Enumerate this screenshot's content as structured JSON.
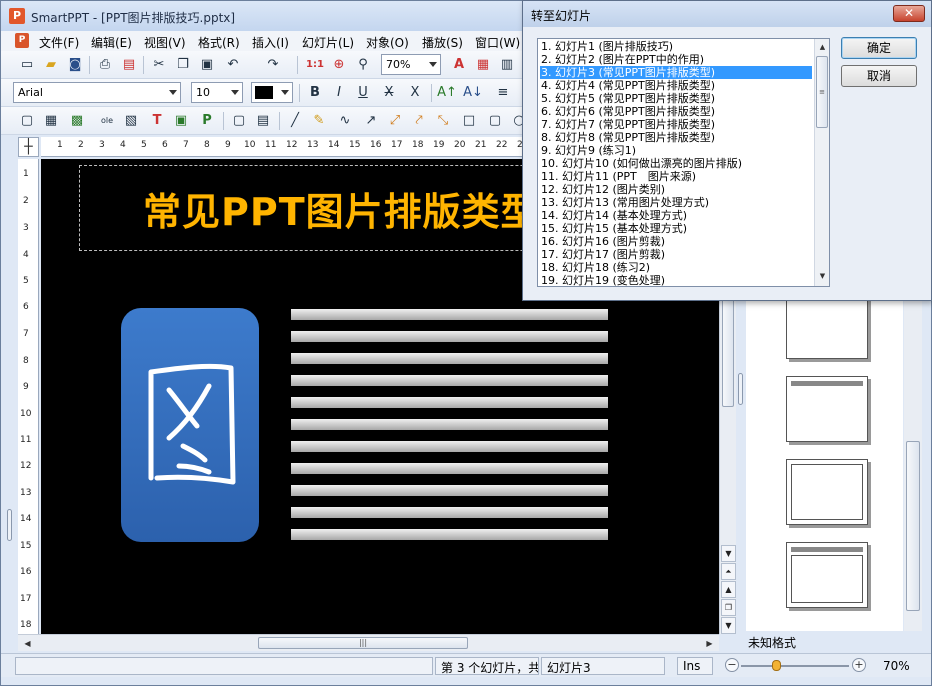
{
  "window": {
    "title": "SmartPPT - [PPT图片排版技巧.pptx]"
  },
  "menu": [
    "文件(F)",
    "编辑(E)",
    "视图(V)",
    "格式(R)",
    "插入(I)",
    "幻灯片(L)",
    "对象(O)",
    "播放(S)",
    "窗口(W)"
  ],
  "toolbar": {
    "zoom_value": "70%",
    "font_name": "Arial",
    "font_size": "10"
  },
  "ruler": {
    "h_ticks": [
      "1",
      "2",
      "3",
      "4",
      "5",
      "6",
      "7",
      "8",
      "9",
      "10",
      "11",
      "12",
      "13",
      "14",
      "15",
      "16",
      "17",
      "18",
      "19",
      "20",
      "21",
      "22",
      "23"
    ],
    "v_ticks": [
      "1",
      "2",
      "3",
      "4",
      "5",
      "6",
      "7",
      "8",
      "9",
      "10",
      "11",
      "12",
      "13",
      "14",
      "15",
      "16",
      "17",
      "18"
    ]
  },
  "slide": {
    "title": "常见PPT图片排版类型",
    "picture_glyph": "图"
  },
  "thumbs": {
    "format_label": "未知格式"
  },
  "status": {
    "slide_info": "第 3 个幻灯片，共",
    "slide_name": "幻灯片3",
    "mode": "Ins",
    "zoom": "70%"
  },
  "dialog": {
    "title": "转至幻灯片",
    "close": "✕",
    "ok": "确定",
    "cancel": "取消",
    "items": [
      "1. 幻灯片1 (图片排版技巧)",
      "2. 幻灯片2 (图片在PPT中的作用)",
      "3. 幻灯片3 (常见PPT图片排版类型)",
      "4. 幻灯片4 (常见PPT图片排版类型)",
      "5. 幻灯片5 (常见PPT图片排版类型)",
      "6. 幻灯片6 (常见PPT图片排版类型)",
      "7. 幻灯片7 (常见PPT图片排版类型)",
      "8. 幻灯片8 (常见PPT图片排版类型)",
      "9. 幻灯片9 (练习1)",
      "10. 幻灯片10 (如何做出漂亮的图片排版)",
      "11. 幻灯片11 (PPT　图片来源)",
      "12. 幻灯片12 (图片类别)",
      "13. 幻灯片13 (常用图片处理方式)",
      "14. 幻灯片14 (基本处理方式)",
      "15. 幻灯片15 (基本处理方式)",
      "16. 幻灯片16 (图片剪裁)",
      "17. 幻灯片17 (图片剪裁)",
      "18. 幻灯片18 (练习2)",
      "19. 幻灯片19 (变色处理)"
    ],
    "selected_index": 2
  },
  "colors": {
    "title_text": "#ffb400",
    "picture_card": "#3d7bcc",
    "selection": "#3399ff"
  }
}
